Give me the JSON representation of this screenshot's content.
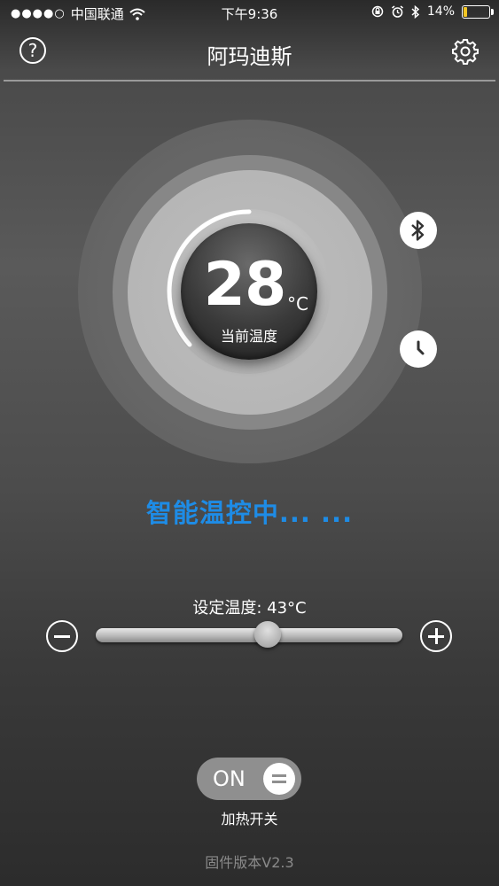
{
  "status_bar": {
    "signal_dots": "●●●●○",
    "carrier": "中国联通",
    "time": "下午9:36",
    "battery_percent": "14%",
    "battery_level": 0.14,
    "icons": [
      "wifi-icon",
      "rotation-lock-icon",
      "alarm-icon",
      "bluetooth-icon",
      "battery-icon"
    ]
  },
  "navbar": {
    "title": "阿玛迪斯",
    "help_symbol": "?",
    "icons": [
      "help-icon",
      "gear-icon"
    ]
  },
  "dial": {
    "current_temp": "28",
    "unit": "°C",
    "label": "当前温度",
    "side_icons": [
      "bluetooth-icon",
      "clock-icon"
    ]
  },
  "status": {
    "text": "智能温控中... ..."
  },
  "setpoint": {
    "label": "设定温度: 43°C",
    "slider_position": 0.56
  },
  "heater_switch": {
    "state": "ON",
    "caption": "加热开关"
  },
  "firmware": {
    "text": "固件版本V2.3"
  },
  "colors": {
    "status_text": "#1e8ce6",
    "battery_fill": "#f3c623"
  }
}
